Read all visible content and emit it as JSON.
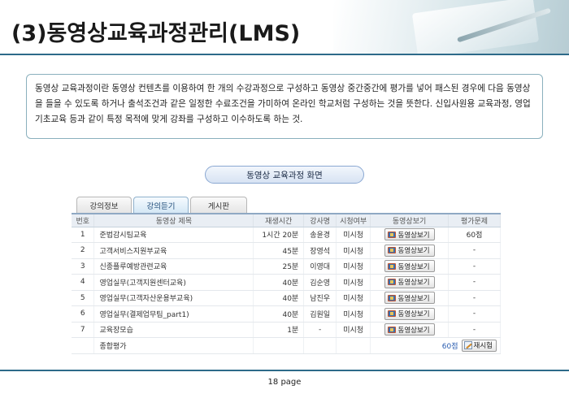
{
  "header": {
    "title": "(3)동영상교육과정관리(LMS)"
  },
  "description": {
    "text": "동영상 교육과정이란 동영상 컨텐츠를 이용하여 한 개의 수강과정으로 구성하고 동영상 중간중간에 평가를 넣어 패스된 경우에 다음 동영상을 들을 수 있도록 하거나 출석조건과 같은 일정한 수료조건을 가미하여 온라인 학교처럼 구성하는 것을 뜻한다. 신입사원용 교육과정, 영업기초교육 등과 같이 특정 목적에 맞게 강좌를 구성하고 이수하도록 하는 것."
  },
  "screen_label": "동영상 교육과정 화면",
  "tabs": [
    {
      "label": "강의정보",
      "active": false
    },
    {
      "label": "강의듣기",
      "active": true
    },
    {
      "label": "게시판",
      "active": false
    }
  ],
  "table": {
    "headers": [
      "번호",
      "동영상 제목",
      "재생시간",
      "강사명",
      "시청여부",
      "동영상보기",
      "평가문제"
    ],
    "rows": [
      {
        "no": "1",
        "title": "준법감시팀교육",
        "time": "1시간 20분",
        "teacher": "송윤경",
        "status": "미시청",
        "view": "동영상보기",
        "eval": "60점"
      },
      {
        "no": "2",
        "title": "고객서비스지원부교육",
        "time": "45분",
        "teacher": "장영석",
        "status": "미시청",
        "view": "동영상보기",
        "eval": "-"
      },
      {
        "no": "3",
        "title": "신종플루예방관련교육",
        "time": "25분",
        "teacher": "이영대",
        "status": "미시청",
        "view": "동영상보기",
        "eval": "-"
      },
      {
        "no": "4",
        "title": "영업실무(고객지원센터교육)",
        "time": "40분",
        "teacher": "김순영",
        "status": "미시청",
        "view": "동영상보기",
        "eval": "-"
      },
      {
        "no": "5",
        "title": "영업실무(고객자산운용부교육)",
        "time": "40분",
        "teacher": "남진우",
        "status": "미시청",
        "view": "동영상보기",
        "eval": "-"
      },
      {
        "no": "6",
        "title": "영업실무(결제업무팀_part1)",
        "time": "40분",
        "teacher": "김원일",
        "status": "미시청",
        "view": "동영상보기",
        "eval": "-"
      },
      {
        "no": "7",
        "title": "교육장모습",
        "time": "1분",
        "teacher": "-",
        "status": "미시청",
        "view": "동영상보기",
        "eval": "-"
      }
    ],
    "summary": {
      "label": "종합평가",
      "score": "60점",
      "retest_label": "재시험"
    }
  },
  "footer": {
    "page": "18 page"
  },
  "colors": {
    "accent_line": "#2d6a89",
    "table_header_bg": "#e9eef4",
    "link": "#2a5db0"
  }
}
